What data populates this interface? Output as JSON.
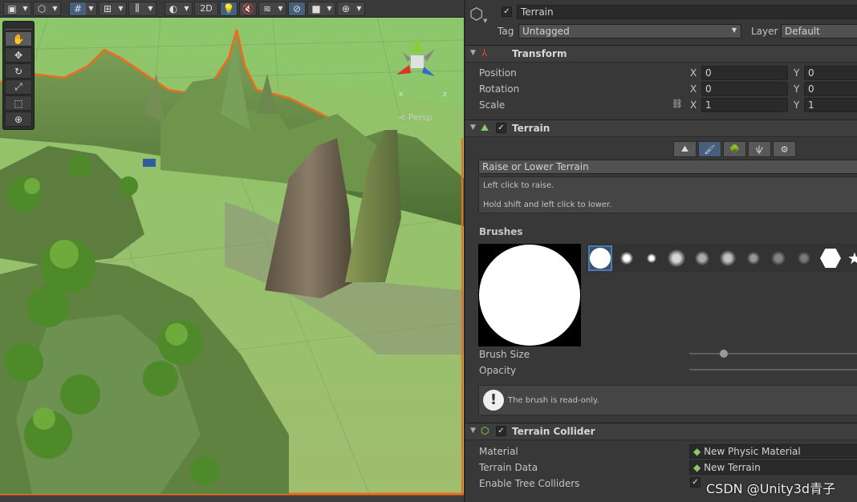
{
  "scene_toolbar": {
    "btn_2d": "2D"
  },
  "viewport": {
    "persp_label": "< Persp",
    "gizmo_axes": {
      "x": "x",
      "z": "z"
    }
  },
  "inspector": {
    "object_name": "Terrain",
    "tag_label": "Tag",
    "tag_value": "Untagged",
    "layer_label": "Layer",
    "layer_value": "Default",
    "transform": {
      "title": "Transform",
      "position_label": "Position",
      "rotation_label": "Rotation",
      "scale_label": "Scale",
      "position": {
        "x": "0",
        "y": "0"
      },
      "rotation": {
        "x": "0",
        "y": "0"
      },
      "scale": {
        "x": "1",
        "y": "1"
      },
      "axis_x": "X",
      "axis_y": "Y"
    },
    "terrain": {
      "title": "Terrain",
      "tool_name": "Raise or Lower Terrain",
      "help_line1": "Left click to raise.",
      "help_line2": "Hold shift and left click to lower.",
      "brushes_label": "Brushes",
      "brush_size_label": "Brush Size",
      "opacity_label": "Opacity",
      "readonly_msg": "The brush is read-only."
    },
    "collider": {
      "title": "Terrain Collider",
      "material_label": "Material",
      "material_value": "New Physic Material",
      "terrain_data_label": "Terrain Data",
      "terrain_data_value": "New Terrain",
      "enable_tree_label": "Enable Tree Colliders"
    }
  },
  "watermark": "CSDN @Unity3d青子",
  "colors": {
    "selection_outline": "#f26a1b",
    "accent_blue": "#46607c",
    "panel_bg": "#383838"
  }
}
